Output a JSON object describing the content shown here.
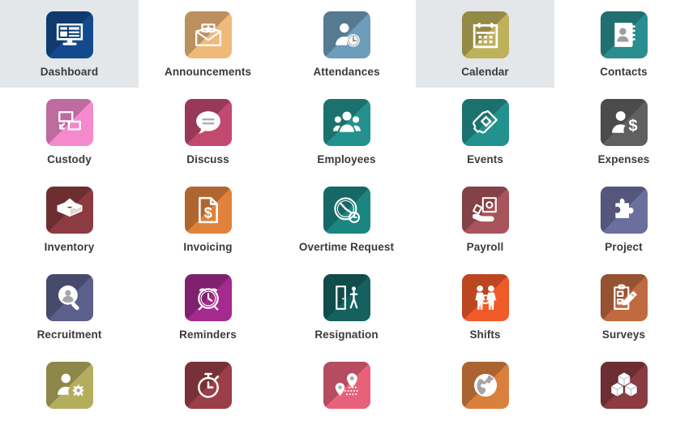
{
  "page": {
    "title": "Apps",
    "background_color": "#ffffff",
    "highlight_color": "#e3e7ea",
    "label_color": "#3a3a3a",
    "columns": 5
  },
  "apps": [
    {
      "label": "Dashboard",
      "icon": "dashboard-monitor-icon",
      "color": "#134a8e",
      "highlighted": true
    },
    {
      "label": "Announcements",
      "icon": "envelope-star-icon",
      "color": "#f0b97a",
      "highlighted": false
    },
    {
      "label": "Attendances",
      "icon": "person-clock-icon",
      "color": "#6e9cbb",
      "highlighted": false
    },
    {
      "label": "Calendar",
      "icon": "calendar-icon",
      "color": "#bfb05a",
      "highlighted": true
    },
    {
      "label": "Contacts",
      "icon": "contact-book-icon",
      "color": "#2a8e90",
      "highlighted": false
    },
    {
      "label": "Custody",
      "icon": "screens-handover-icon",
      "color": "#f489cd",
      "highlighted": false
    },
    {
      "label": "Discuss",
      "icon": "speech-bubble-icon",
      "color": "#c2496f",
      "highlighted": false
    },
    {
      "label": "Employees",
      "icon": "people-group-icon",
      "color": "#23918d",
      "highlighted": false
    },
    {
      "label": "Events",
      "icon": "ticket-icon",
      "color": "#23918d",
      "highlighted": false
    },
    {
      "label": "Expenses",
      "icon": "person-dollar-icon",
      "color": "#606060",
      "highlighted": false
    },
    {
      "label": "Inventory",
      "icon": "open-box-icon",
      "color": "#8c3b40",
      "highlighted": false
    },
    {
      "label": "Invoicing",
      "icon": "invoice-dollar-icon",
      "color": "#e0823c",
      "highlighted": false
    },
    {
      "label": "Overtime Request",
      "icon": "gauge-clock-icon",
      "color": "#1b8581",
      "highlighted": false
    },
    {
      "label": "Payroll",
      "icon": "hand-money-icon",
      "color": "#a8545b",
      "highlighted": false
    },
    {
      "label": "Project",
      "icon": "puzzle-piece-icon",
      "color": "#6b6f9e",
      "highlighted": false
    },
    {
      "label": "Recruitment",
      "icon": "magnifier-person-icon",
      "color": "#5a5f8c",
      "highlighted": false
    },
    {
      "label": "Reminders",
      "icon": "alarm-clock-icon",
      "color": "#a42a8e",
      "highlighted": false
    },
    {
      "label": "Resignation",
      "icon": "door-exit-icon",
      "color": "#14615f",
      "highlighted": false
    },
    {
      "label": "Shifts",
      "icon": "two-people-icon",
      "color": "#f15a29",
      "highlighted": false
    },
    {
      "label": "Surveys",
      "icon": "clipboard-pencil-icon",
      "color": "#c06a3f",
      "highlighted": false
    },
    {
      "label": "",
      "icon": "person-gear-icon",
      "color": "#b5ad5e",
      "highlighted": false
    },
    {
      "label": "",
      "icon": "stopwatch-icon",
      "color": "#9a3f47",
      "highlighted": false
    },
    {
      "label": "",
      "icon": "map-pins-route-icon",
      "color": "#e8617a",
      "highlighted": false
    },
    {
      "label": "",
      "icon": "globe-icon",
      "color": "#d9803f",
      "highlighted": false
    },
    {
      "label": "",
      "icon": "cubes-icon",
      "color": "#8c3b40",
      "highlighted": false
    }
  ]
}
